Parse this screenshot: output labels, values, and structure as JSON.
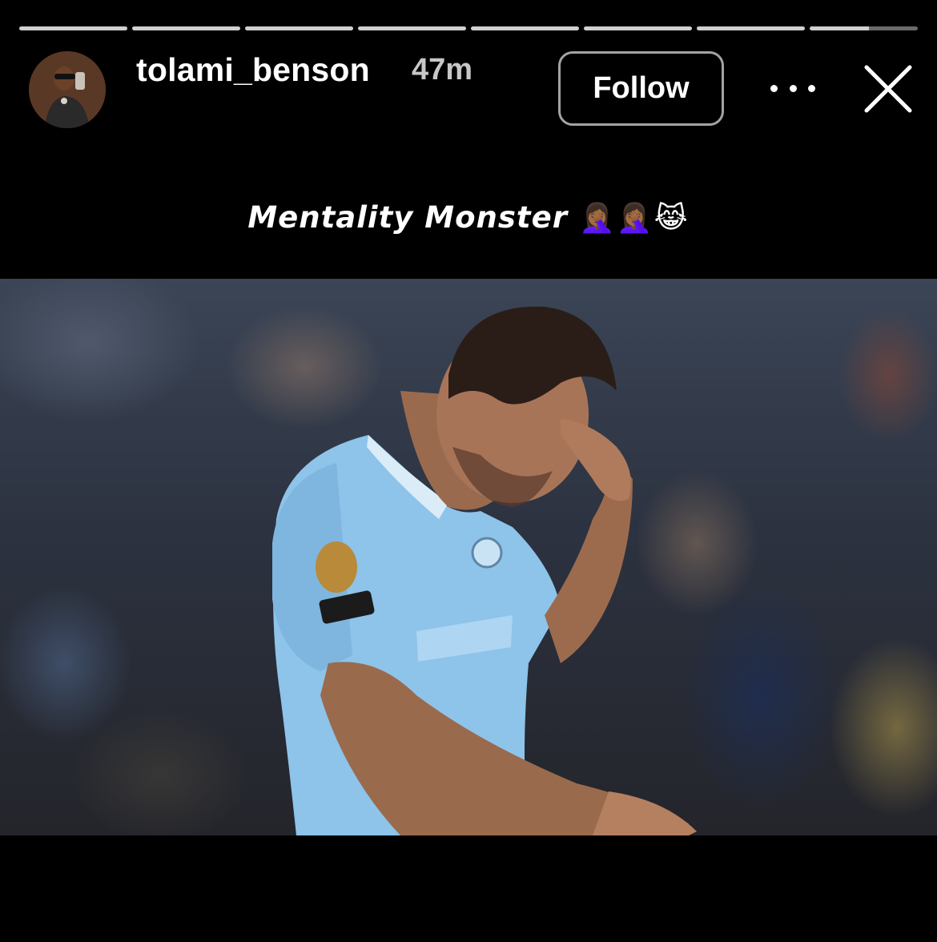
{
  "story": {
    "progress_segments": 8,
    "active_segment": 8,
    "active_segment_fraction": 0.55
  },
  "header": {
    "username": "tolami_benson",
    "timestamp": "47m",
    "follow_label": "Follow",
    "more_icon": "more-horizontal-icon",
    "close_icon": "close-icon"
  },
  "caption": {
    "text": "Mentality Monster",
    "emojis": "🤦🏾‍♀️🤦🏾‍♀️😹"
  },
  "colors": {
    "background": "#000000",
    "timestamp_gray": "#c7c7c7",
    "progress": "#cfcfcf",
    "jersey_blue": "#8ec3ea"
  }
}
